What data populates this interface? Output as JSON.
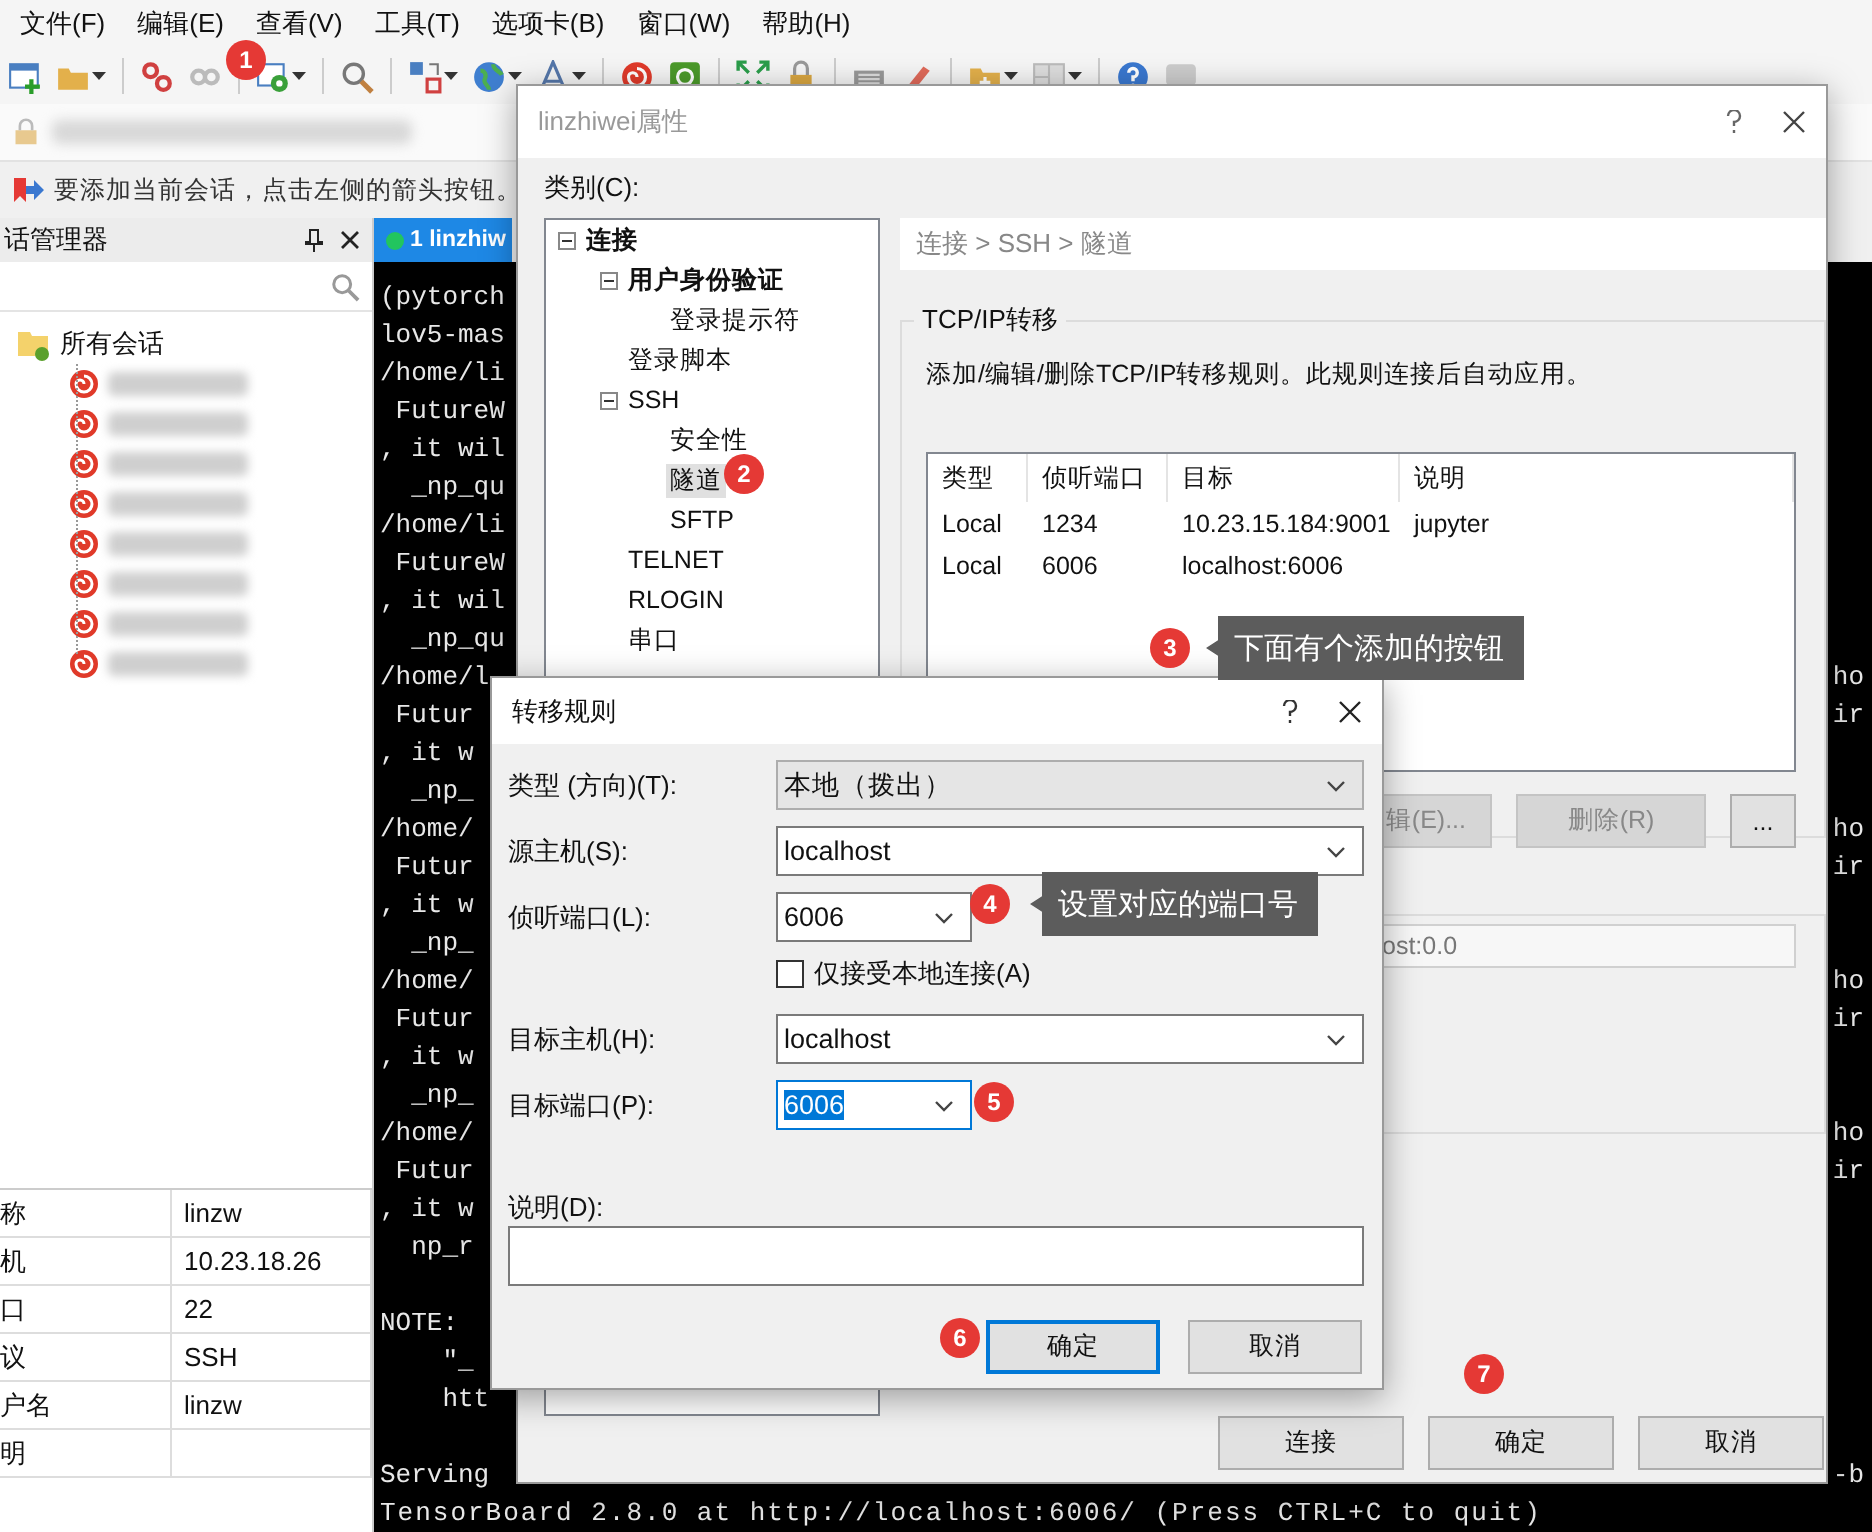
{
  "menu": [
    {
      "label": "文件(F)"
    },
    {
      "label": "编辑(E)"
    },
    {
      "label": "查看(V)"
    },
    {
      "label": "工具(T)"
    },
    {
      "label": "选项卡(B)"
    },
    {
      "label": "窗口(W)"
    },
    {
      "label": "帮助(H)"
    }
  ],
  "hint": "要添加当前会话，点击左侧的箭头按钮。",
  "session_manager": {
    "title": "话管理器",
    "root": {
      "label": "所有会话",
      "expanded": true
    },
    "sessions": [
      {
        "kind": "blurred"
      },
      {
        "kind": "blurred"
      },
      {
        "kind": "blurred"
      },
      {
        "kind": "blurred"
      },
      {
        "kind": "blurred"
      },
      {
        "kind": "blurred"
      },
      {
        "kind": "blurred"
      },
      {
        "kind": "blurred"
      }
    ],
    "properties": [
      {
        "name": "称",
        "value": "linzw"
      },
      {
        "name": "机",
        "value": "10.23.18.26"
      },
      {
        "name": "口",
        "value": "22"
      },
      {
        "name": "议",
        "value": "SSH"
      },
      {
        "name": "户名",
        "value": "linzw"
      },
      {
        "name": "明"
      }
    ]
  },
  "terminal": {
    "tab": {
      "label": "1 linzhiw",
      "connected": true,
      "selected": true
    },
    "lines": [
      {
        "left": "(pytorch"
      },
      {
        "left": "lov5-mas"
      },
      {
        "left": "/home/li"
      },
      {
        "left": " FutureW"
      },
      {
        "left": ", it wil"
      },
      {
        "left": "  _np_qu"
      },
      {
        "left": "/home/li"
      },
      {
        "left": " FutureW"
      },
      {
        "left": ", it wil"
      },
      {
        "left": "  _np_qu"
      },
      {
        "left": "/home/l",
        "right": "ho"
      },
      {
        "left": " Futur",
        "right": "ir"
      },
      {
        "left": ", it w"
      },
      {
        "left": "  _np_"
      },
      {
        "left": "/home/",
        "right": "ho"
      },
      {
        "left": " Futur",
        "right": "ir"
      },
      {
        "left": ", it w"
      },
      {
        "left": "  _np_"
      },
      {
        "left": "/home/",
        "right": "ho"
      },
      {
        "left": " Futur",
        "right": "ir"
      },
      {
        "left": ", it w"
      },
      {
        "left": "  _np_"
      },
      {
        "left": "/home/",
        "right": "ho"
      },
      {
        "left": " Futur",
        "right": "ir"
      },
      {
        "left": ", it w"
      },
      {
        "left": "  np_r"
      },
      {
        "left": "NOTE:",
        "blank_before": true
      },
      {
        "left": "    \"_"
      },
      {
        "left": "    htt"
      },
      {
        "left": "Serving",
        "right": "-b",
        "blank_before": true
      },
      {
        "left": "TensorBoard 2.8.0 at http://localhost:6006/ (Press CTRL+C to quit)"
      }
    ]
  },
  "properties_dialog": {
    "title": "linzhiwei属性",
    "category_label": "类别(C):",
    "tree": [
      {
        "label": "连接",
        "bold": true,
        "selected": false,
        "expanded": true,
        "children": [
          {
            "label": "用户身份验证",
            "bold": true,
            "selected": false,
            "expanded": true,
            "children": [
              {
                "label": "登录提示符",
                "bold": false,
                "selected": false
              }
            ]
          },
          {
            "label": "登录脚本",
            "bold": false,
            "selected": false
          },
          {
            "label": "SSH",
            "bold": false,
            "selected": false,
            "expanded": true,
            "children": [
              {
                "label": "安全性",
                "bold": false,
                "selected": false
              },
              {
                "label": "隧道",
                "bold": false,
                "selected": true
              },
              {
                "label": "SFTP",
                "bold": false,
                "selected": false
              }
            ]
          },
          {
            "label": "TELNET",
            "bold": false,
            "selected": false
          },
          {
            "label": "RLOGIN",
            "bold": false,
            "selected": false
          },
          {
            "label": "串口",
            "bold": false,
            "selected": false
          }
        ]
      }
    ],
    "breadcrumb": "连接 > SSH > 隧道",
    "group_title": "TCP/IP转移",
    "description": "添加/编辑/删除TCP/IP转移规则。此规则连接后自动应用。",
    "rules": {
      "columns": [
        "类型",
        "侦听端口",
        "目标",
        "说明"
      ],
      "rows": [
        [
          "Local",
          "1234",
          "10.23.15.184:9001",
          "jupyter"
        ],
        [
          "Local",
          "6006",
          "localhost:6006",
          ""
        ]
      ]
    },
    "rule_buttons": [
      {
        "label": "辑(E)...",
        "disabled": true
      },
      {
        "label": "删除(R)",
        "disabled": true
      },
      {
        "label": "...",
        "disabled": false
      }
    ],
    "x11_field": "ost:0.0",
    "buttons": [
      {
        "label": "连接"
      },
      {
        "label": "确定"
      },
      {
        "label": "取消"
      }
    ]
  },
  "rule_dialog": {
    "title": "转移规则",
    "fields": [
      {
        "label": "类型 (方向)(T):",
        "value": "本地（拨出）",
        "kind": "dropdown",
        "highlighted": false
      },
      {
        "label": "源主机(S):",
        "value": "localhost",
        "kind": "combo",
        "highlighted": false
      },
      {
        "label": "侦听端口(L):",
        "value": "6006",
        "kind": "port",
        "highlighted": false
      },
      {
        "label": "仅接受本地连接(A)",
        "kind": "checkbox",
        "checked": false
      },
      {
        "label": "目标主机(H):",
        "value": "localhost",
        "kind": "combo",
        "highlighted": false
      },
      {
        "label": "目标端口(P):",
        "value": "6006",
        "kind": "port",
        "highlighted": true
      }
    ],
    "note_label": "说明(D):",
    "buttons": [
      {
        "label": "确定",
        "default": true
      },
      {
        "label": "取消",
        "default": false
      }
    ]
  },
  "annotations": [
    {
      "number": "1"
    },
    {
      "number": "2"
    },
    {
      "number": "3",
      "note": "下面有个添加的按钮"
    },
    {
      "number": "4",
      "note": "设置对应的端口号"
    },
    {
      "number": "5"
    },
    {
      "number": "6"
    },
    {
      "number": "7"
    }
  ]
}
